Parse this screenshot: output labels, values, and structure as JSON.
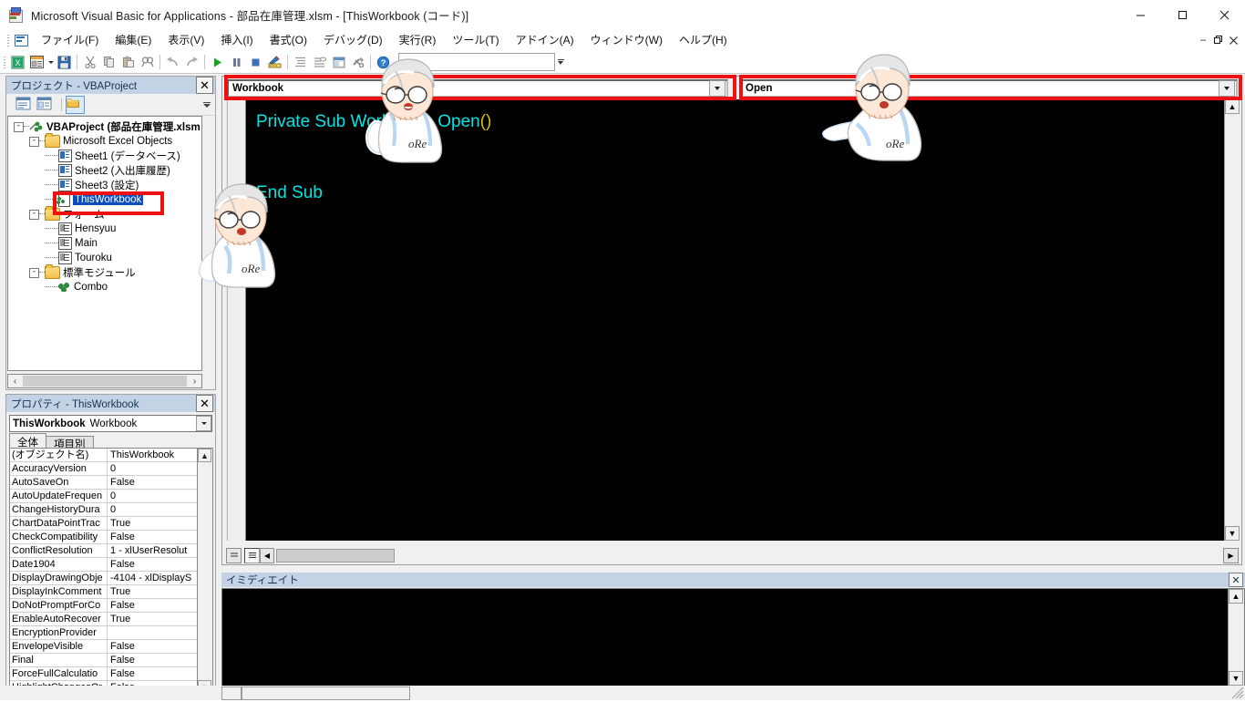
{
  "window": {
    "title": "Microsoft Visual Basic for Applications - 部品在庫管理.xlsm - [ThisWorkbook (コード)]",
    "minimize": "—",
    "maximize": "□",
    "close": "✕"
  },
  "menu": {
    "items": [
      {
        "text": "ファイル(F)",
        "mnemonic": "F"
      },
      {
        "text": "編集(E)",
        "mnemonic": "E"
      },
      {
        "text": "表示(V)",
        "mnemonic": "V"
      },
      {
        "text": "挿入(I)",
        "mnemonic": "I"
      },
      {
        "text": "書式(O)",
        "mnemonic": "O"
      },
      {
        "text": "デバッグ(D)",
        "mnemonic": "D"
      },
      {
        "text": "実行(R)",
        "mnemonic": "R"
      },
      {
        "text": "ツール(T)",
        "mnemonic": "T"
      },
      {
        "text": "アドイン(A)",
        "mnemonic": "A"
      },
      {
        "text": "ウィンドウ(W)",
        "mnemonic": "W"
      },
      {
        "text": "ヘルプ(H)",
        "mnemonic": "H"
      }
    ],
    "mdi_restore": "🗗",
    "mdi_minimize": "–",
    "mdi_close": "✕"
  },
  "toolbar": {
    "buttons": [
      "view-excel-icon",
      "insert-userform-icon",
      "insert-dropdown-icon",
      "save-icon",
      "cut-icon",
      "copy-icon",
      "paste-icon",
      "find-icon",
      "undo-icon",
      "redo-icon",
      "run-icon",
      "break-icon",
      "reset-icon",
      "design-mode-icon",
      "project-explorer-icon",
      "properties-window-icon",
      "object-browser-icon",
      "toolbox-icon",
      "help-icon"
    ]
  },
  "project_explorer": {
    "title": "プロジェクト - VBAProject",
    "close_label": "✕",
    "toolbar_buttons": [
      "view-code-icon",
      "view-object-icon",
      "toggle-folders-icon"
    ],
    "tree": [
      {
        "depth": 0,
        "label": "VBAProject (部品在庫管理.xlsm",
        "icon": "vbproject-icon",
        "expander": "-",
        "bold": true,
        "selected": false
      },
      {
        "depth": 1,
        "label": "Microsoft Excel Objects",
        "icon": "folder-icon",
        "expander": "-",
        "bold": false,
        "selected": false
      },
      {
        "depth": 2,
        "label": "Sheet1 (データベース)",
        "icon": "worksheet-icon",
        "expander": "",
        "bold": false,
        "selected": false
      },
      {
        "depth": 2,
        "label": "Sheet2 (入出庫履歴)",
        "icon": "worksheet-icon",
        "expander": "",
        "bold": false,
        "selected": false
      },
      {
        "depth": 2,
        "label": "Sheet3 (設定)",
        "icon": "worksheet-icon",
        "expander": "",
        "bold": false,
        "selected": false
      },
      {
        "depth": 2,
        "label": "ThisWorkbook",
        "icon": "thisworkbook-icon",
        "expander": "",
        "bold": false,
        "selected": true
      },
      {
        "depth": 1,
        "label": "フォーム",
        "icon": "folder-icon",
        "expander": "-",
        "bold": false,
        "selected": false
      },
      {
        "depth": 2,
        "label": "Hensyuu",
        "icon": "userform-icon",
        "expander": "",
        "bold": false,
        "selected": false
      },
      {
        "depth": 2,
        "label": "Main",
        "icon": "userform-icon",
        "expander": "",
        "bold": false,
        "selected": false
      },
      {
        "depth": 2,
        "label": "Touroku",
        "icon": "userform-icon",
        "expander": "",
        "bold": false,
        "selected": false
      },
      {
        "depth": 1,
        "label": "標準モジュール",
        "icon": "folder-icon",
        "expander": "-",
        "bold": false,
        "selected": false
      },
      {
        "depth": 2,
        "label": "Combo",
        "icon": "module-icon",
        "expander": "",
        "bold": false,
        "selected": false
      }
    ],
    "scroll_left": "‹",
    "scroll_right": "›"
  },
  "properties": {
    "title": "プロパティ - ThisWorkbook",
    "close_label": "✕",
    "object_name": "ThisWorkbook",
    "object_type": "Workbook",
    "tabs": [
      {
        "label": "全体",
        "active": true
      },
      {
        "label": "項目別",
        "active": false
      }
    ],
    "rows": [
      {
        "name": "(オブジェクト名)",
        "value": "ThisWorkbook"
      },
      {
        "name": "AccuracyVersion",
        "value": "0"
      },
      {
        "name": "AutoSaveOn",
        "value": "False"
      },
      {
        "name": "AutoUpdateFrequen",
        "value": "0"
      },
      {
        "name": "ChangeHistoryDura",
        "value": "0"
      },
      {
        "name": "ChartDataPointTrac",
        "value": "True"
      },
      {
        "name": "CheckCompatibility",
        "value": "False"
      },
      {
        "name": "ConflictResolution",
        "value": "1 - xlUserResolut"
      },
      {
        "name": "Date1904",
        "value": "False"
      },
      {
        "name": "DisplayDrawingObje",
        "value": "-4104 - xlDisplayS"
      },
      {
        "name": "DisplayInkComment",
        "value": "True"
      },
      {
        "name": "DoNotPromptForCo",
        "value": "False"
      },
      {
        "name": "EnableAutoRecover",
        "value": "True"
      },
      {
        "name": "EncryptionProvider",
        "value": ""
      },
      {
        "name": "EnvelopeVisible",
        "value": "False"
      },
      {
        "name": "Final",
        "value": "False"
      },
      {
        "name": "ForceFullCalculatio",
        "value": "False"
      },
      {
        "name": "HighlightChangesOr",
        "value": "False"
      }
    ],
    "scroll_up": "▲",
    "scroll_down": "▼"
  },
  "code_window": {
    "object_dropdown": {
      "value": "Workbook",
      "arrow": "▼"
    },
    "procedure_dropdown": {
      "value": "Open",
      "arrow": "▼"
    },
    "code_line_1": "Private Sub Workbook_Open",
    "code_line_1_parens": "()",
    "code_line_2": "End Sub",
    "view_procedure_button": "procedure-view-icon",
    "view_module_button": "full-module-view-icon",
    "scroll_up": "▲",
    "scroll_down": "▼",
    "scroll_left": "◀",
    "scroll_right": "▶"
  },
  "immediate_window": {
    "title": "イミディエイト",
    "close_label": "✕",
    "content": "",
    "scroll_up": "▲",
    "scroll_down": "▼"
  },
  "annotations": {
    "highlight_color": "#ee1111",
    "boxes": [
      {
        "name": "object-dropdown-highlight"
      },
      {
        "name": "procedure-dropdown-highlight"
      },
      {
        "name": "thisworkbook-node-highlight"
      }
    ]
  },
  "mascots": [
    {
      "name": "mascot-character-top-left",
      "shirt_text": "oRe"
    },
    {
      "name": "mascot-character-top-right",
      "shirt_text": "oRe"
    },
    {
      "name": "mascot-character-tree",
      "shirt_text": "oRe"
    }
  ]
}
